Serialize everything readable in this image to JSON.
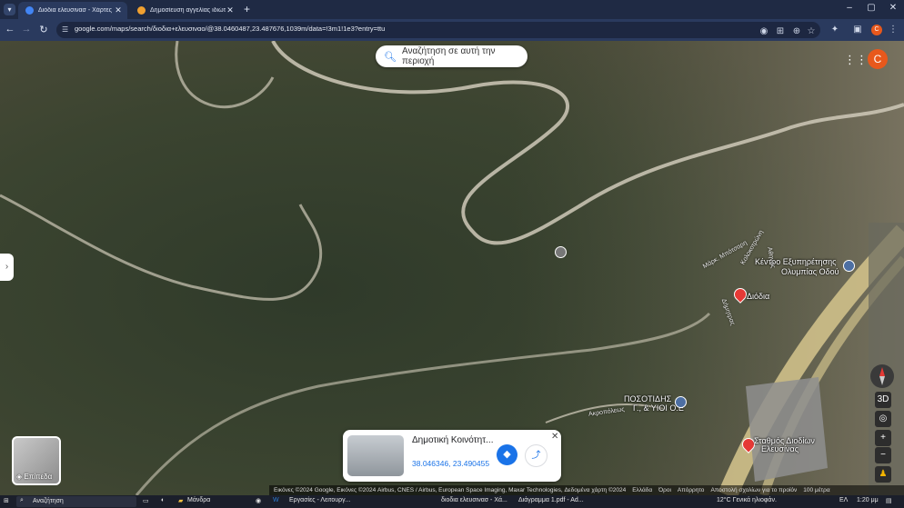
{
  "browser": {
    "tabs": [
      {
        "title": "Διόδια ελευσινασ - Χάρτες Goo",
        "active": true,
        "favicon_color": "#4285f4"
      },
      {
        "title": "Δημοσίευση αγγελίας ιδιώτη |",
        "active": false,
        "favicon_color": "#f0a030"
      }
    ],
    "new_tab": "+",
    "window_controls": {
      "minimize": "–",
      "maximize": "▢",
      "close": "✕"
    },
    "url": "google.com/maps/search/διοδια+ελευσιναο/@38.0460487,23.487676,1039m/data=!3m1!1e3?entry=ttu",
    "profile_letter": "C"
  },
  "map": {
    "search_area_label": "Αναζήτηση σε αυτή την περιοχή",
    "avatar_letter": "C",
    "labels": {
      "service_center": "Κέντρο Εξυπηρέτησης",
      "olympia_road": "Ολυμπίας Οδού",
      "tolls": "Διόδια",
      "posotidis": "ΠΟΣΟΤΙΔΗΣ",
      "posotidis_2": "Γ., & ΥΙΟΙ Ο.Ε",
      "station": "Σταθμός Διοδίων",
      "station_2": "Ελευσίνας"
    },
    "road_labels": {
      "road1": "Μάρκ. Μπότσαρη",
      "road2": "Κολοκοτρώνη",
      "road3": "Αθηνάς",
      "road4": "Ακροπόλεως",
      "road5": "Δήμητρας"
    },
    "layers_label": "Επίπεδα",
    "controls": {
      "three_d": "3D",
      "zoom_in": "+",
      "zoom_out": "−"
    },
    "card": {
      "title": "Δημοτική Κοινότητ...",
      "coords": "38.046346, 23.490455"
    },
    "attribution": {
      "imagery": "Εικόνες ©2024 Google, Εικόνες ©2024 Airbus, CNES / Airbus, European Space Imaging, Maxar Technologies, Δεδομένα χάρτη ©2024",
      "country": "Ελλάδα",
      "terms": "Όροι",
      "privacy": "Απόρρητο",
      "feedback": "Αποστολή σχολίων για το προϊόν",
      "scale": "100 μέτρα"
    }
  },
  "taskbar": {
    "search_placeholder": "Αναζήτηση",
    "items": [
      "Μάνδρα",
      "Εργασίες - Λειτουργ...",
      "διοδια ελευσινασ - Χά...",
      "Διάγραμμα 1.pdf - Ad..."
    ],
    "weather": "12°C Γενικά ηλιοφάν.",
    "lang": "ΕΛ",
    "time": "1:20 μμ"
  },
  "colors": {
    "accent": "#1a73e8",
    "pin": "#e53935",
    "avatar": "#e8581c"
  }
}
